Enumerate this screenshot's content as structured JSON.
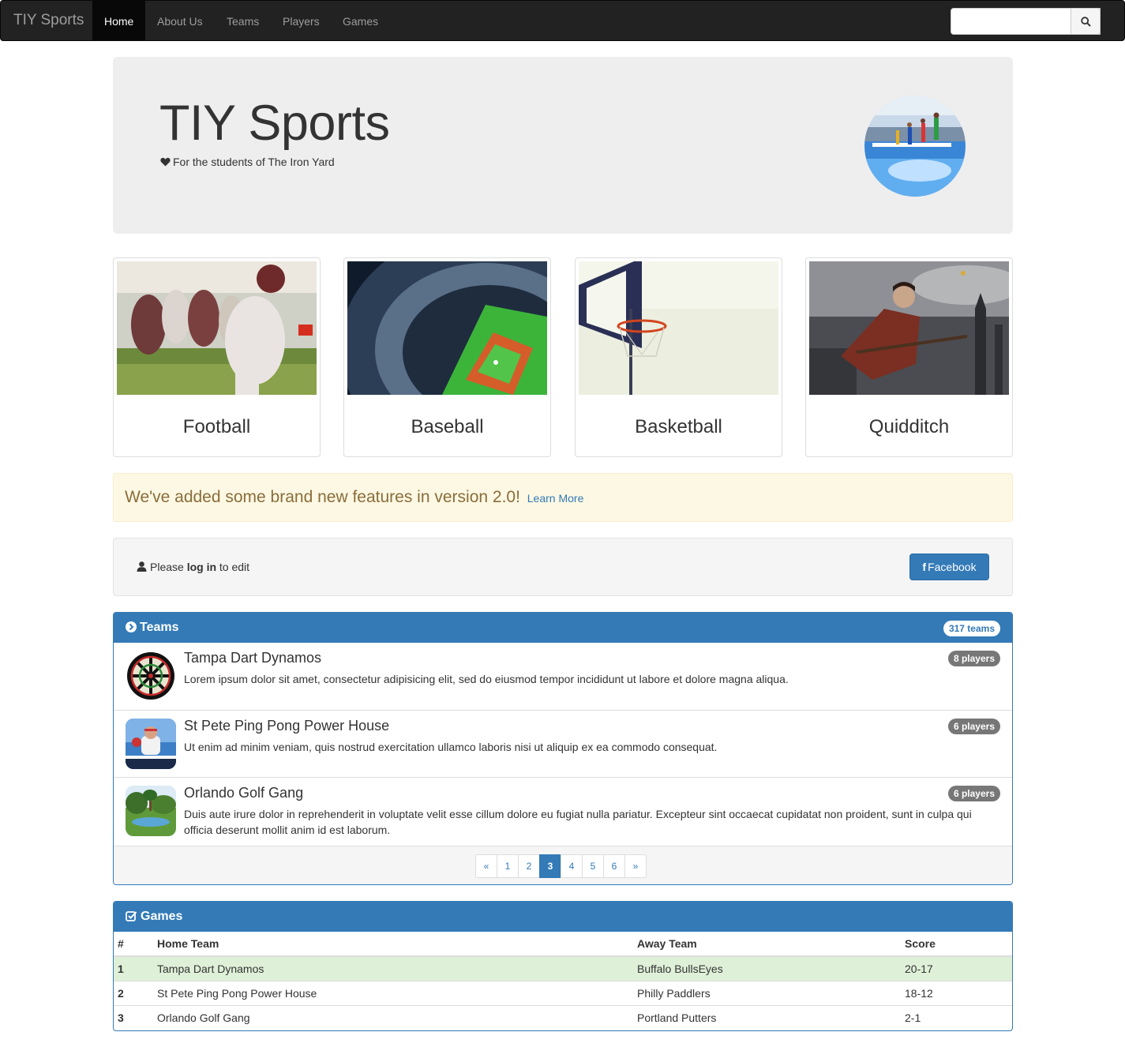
{
  "navbar": {
    "brand": "TIY Sports",
    "items": [
      {
        "label": "Home",
        "active": true
      },
      {
        "label": "About Us"
      },
      {
        "label": "Teams"
      },
      {
        "label": "Players"
      },
      {
        "label": "Games"
      }
    ],
    "search_placeholder": "",
    "search_icon": "search-icon"
  },
  "jumbotron": {
    "title": "TIY Sports",
    "subtitle": "For the students of The Iron Yard",
    "subtitle_icon": "heart-icon"
  },
  "sports": [
    {
      "label": "Football"
    },
    {
      "label": "Baseball"
    },
    {
      "label": "Basketball"
    },
    {
      "label": "Quidditch"
    }
  ],
  "alert": {
    "text": "We've added some brand new features in version 2.0!",
    "link": "Learn More"
  },
  "login": {
    "prefix": "Please",
    "action": "log in",
    "suffix": "to edit",
    "facebook_label": "Facebook"
  },
  "teams_panel": {
    "title": "Teams",
    "count_badge": "317 teams",
    "teams": [
      {
        "name": "Tampa Dart Dynamos",
        "description": "Lorem ipsum dolor sit amet, consectetur adipisicing elit, sed do eiusmod tempor incididunt ut labore et dolore magna aliqua.",
        "players": "8 players"
      },
      {
        "name": "St Pete Ping Pong Power House",
        "description": "Ut enim ad minim veniam, quis nostrud exercitation ullamco laboris nisi ut aliquip ex ea commodo consequat.",
        "players": "6 players"
      },
      {
        "name": "Orlando Golf Gang",
        "description": "Duis aute irure dolor in reprehenderit in voluptate velit esse cillum dolore eu fugiat nulla pariatur. Excepteur sint occaecat cupidatat non proident, sunt in culpa qui officia deserunt mollit anim id est laborum.",
        "players": "6 players"
      }
    ],
    "pagination": [
      "«",
      "1",
      "2",
      "3",
      "4",
      "5",
      "6",
      "»"
    ],
    "active_page": "3"
  },
  "games_panel": {
    "title": "Games",
    "columns": [
      "#",
      "Home Team",
      "Away Team",
      "Score"
    ],
    "rows": [
      {
        "num": "1",
        "home": "Tampa Dart Dynamos",
        "away": "Buffalo BullsEyes",
        "score": "20-17"
      },
      {
        "num": "2",
        "home": "St Pete Ping Pong Power House",
        "away": "Philly Paddlers",
        "score": "18-12"
      },
      {
        "num": "3",
        "home": "Orlando Golf Gang",
        "away": "Portland Putters",
        "score": "2-1"
      }
    ]
  },
  "colors": {
    "primary": "#337ab7",
    "navbar": "#222222",
    "alert_bg": "#fcf8e3",
    "success_row": "#dff0d8"
  }
}
